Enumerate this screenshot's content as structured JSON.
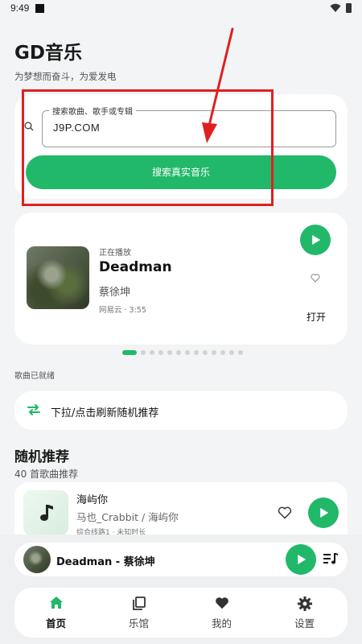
{
  "status_bar": {
    "time": "9:49"
  },
  "header": {
    "title": "GD音乐",
    "subtitle": "为梦想而奋斗，为爱发电"
  },
  "search": {
    "field_label": "搜索歌曲、歌手或专辑",
    "value": "J9P.COM",
    "button_label": "搜索真实音乐"
  },
  "now_playing": {
    "label": "正在播放",
    "title": "Deadman",
    "artist": "蔡徐坤",
    "meta": "网易云 · 3:55",
    "open_label": "打开"
  },
  "carousel": {
    "count": 13,
    "active_index": 0
  },
  "status_text": "歌曲已就绪",
  "refresh": {
    "label": "下拉/点击刷新随机推荐"
  },
  "recommend": {
    "title": "随机推荐",
    "subtitle": "40 首歌曲推荐",
    "items": [
      {
        "title": "海屿你",
        "artist": "马也_Crabbit / 海屿你",
        "meta": "综合线路1 · 未知时长"
      }
    ]
  },
  "mini_player": {
    "text": "Deadman - 蔡徐坤"
  },
  "nav": {
    "items": [
      {
        "label": "首页",
        "icon": "home-icon",
        "active": true
      },
      {
        "label": "乐馆",
        "icon": "library-icon",
        "active": false
      },
      {
        "label": "我的",
        "icon": "heart-icon",
        "active": false
      },
      {
        "label": "设置",
        "icon": "gear-icon",
        "active": false
      }
    ]
  },
  "colors": {
    "accent": "#21b86a",
    "annotation": "#e02020",
    "background": "#f2f4f5"
  }
}
